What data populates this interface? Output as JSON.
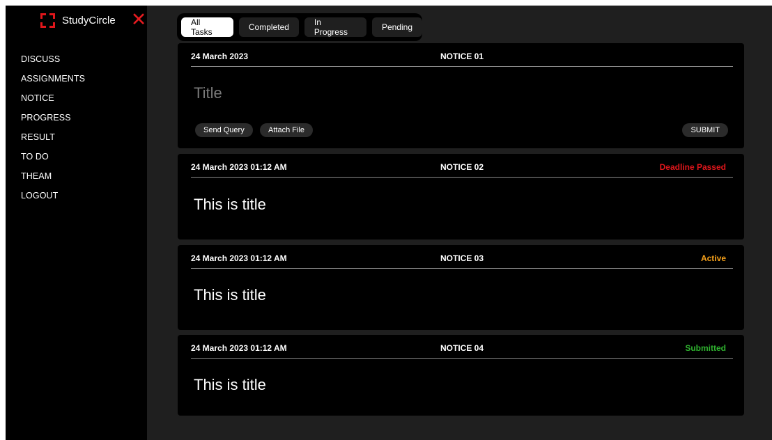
{
  "brand": {
    "name": "StudyCircle",
    "logo_icon": "frame-corners-icon",
    "close_icon": "close-icon",
    "close_glyph": "✕"
  },
  "sidebar": {
    "items": [
      {
        "label": "DISCUSS"
      },
      {
        "label": "ASSIGNMENTS"
      },
      {
        "label": "NOTICE"
      },
      {
        "label": "PROGRESS"
      },
      {
        "label": "RESULT"
      },
      {
        "label": "TO DO"
      },
      {
        "label": "THEAM"
      },
      {
        "label": "LOGOUT"
      }
    ]
  },
  "tabs": [
    {
      "label": "All Tasks",
      "active": true
    },
    {
      "label": "Completed"
    },
    {
      "label": "In Progress"
    },
    {
      "label": "Pending"
    }
  ],
  "compose": {
    "date": "24 March 2023",
    "notice": "NOTICE 01",
    "title_placeholder": "Title",
    "send_query_label": "Send Query",
    "attach_file_label": "Attach File",
    "submit_label": "SUBMIT"
  },
  "notices": [
    {
      "date": "24 March 2023  01:12 AM",
      "notice": "NOTICE 02",
      "status": "Deadline Passed",
      "status_color": "#e0161b",
      "title": "This is title"
    },
    {
      "date": "24 March 2023  01:12 AM",
      "notice": "NOTICE 03",
      "status": "Active",
      "status_color": "#f5a01a",
      "title": "This is title"
    },
    {
      "date": "24 March 2023  01:12 AM",
      "notice": "NOTICE 04",
      "status": "Submitted",
      "status_color": "#2fb32f",
      "title": "This is title"
    }
  ],
  "colors": {
    "accent": "#e0161b",
    "background": "#1f1f1f",
    "panel": "#000000"
  }
}
